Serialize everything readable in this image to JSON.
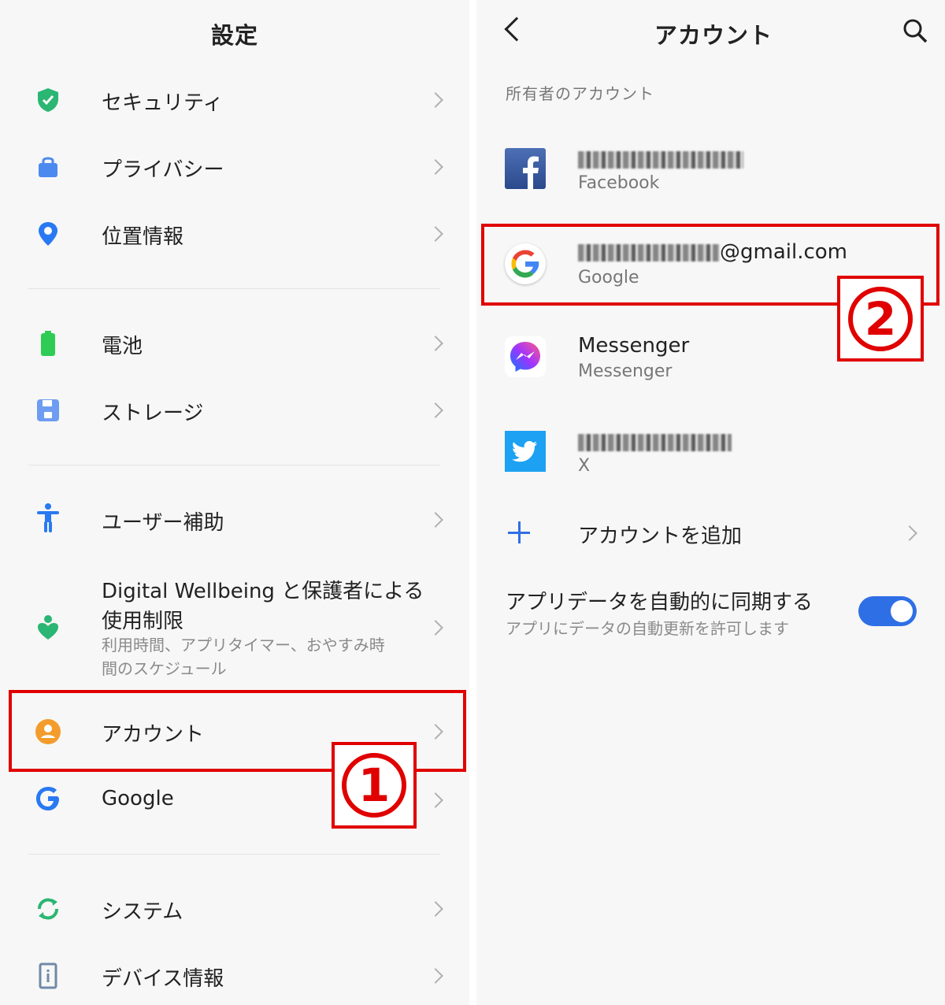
{
  "settings": {
    "title": "設定",
    "items": [
      {
        "label": "セキュリティ"
      },
      {
        "label": "プライバシー"
      },
      {
        "label": "位置情報"
      },
      {
        "label": "電池"
      },
      {
        "label": "ストレージ"
      },
      {
        "label": "ユーザー補助"
      },
      {
        "label_line1": "Digital Wellbeing と保護者による",
        "label_line2": "使用制限",
        "sub_line1": "利用時間、アプリタイマー、おやすみ時",
        "sub_line2": "間のスケジュール"
      },
      {
        "label": "アカウント"
      },
      {
        "label": "Google"
      },
      {
        "label": "システム"
      },
      {
        "label": "デバイス情報"
      }
    ]
  },
  "accounts": {
    "title": "アカウント",
    "section_label": "所有者のアカウント",
    "list": [
      {
        "name": "",
        "service": "Facebook"
      },
      {
        "name_suffix": "@gmail.com",
        "service": "Google"
      },
      {
        "name": "Messenger",
        "service": "Messenger"
      },
      {
        "name": "",
        "service": "X"
      }
    ],
    "add_account": "アカウントを追加",
    "sync": {
      "title": "アプリデータを自動的に同期する",
      "subtitle": "アプリにデータの自動更新を許可します",
      "enabled": true
    }
  },
  "annotations": {
    "step1": "①",
    "step2": "②"
  },
  "colors": {
    "highlight": "#e00000",
    "toggle": "#2f6fe6",
    "security": "#2bb673",
    "privacy": "#4d8af0",
    "location": "#2979f2",
    "battery": "#2ecc55",
    "account": "#f39c2c"
  }
}
